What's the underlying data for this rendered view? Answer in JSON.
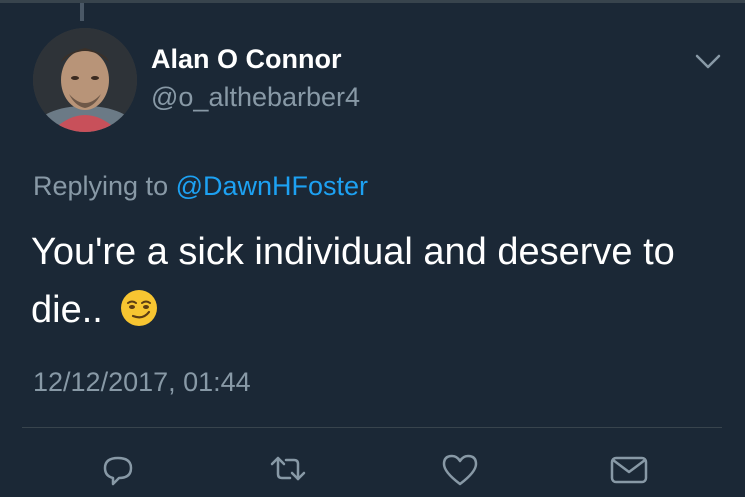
{
  "tweet": {
    "author": {
      "display_name": "Alan O Connor",
      "handle": "@o_althebarber4"
    },
    "reply_prefix": "Replying to ",
    "reply_to": "@DawnHFoster",
    "text": "You're a sick individual and deserve to die..",
    "emoji": "smirking-face",
    "timestamp": "12/12/2017, 01:44"
  },
  "colors": {
    "background": "#1b2836",
    "secondary_text": "#8899a6",
    "link": "#1da1f2"
  },
  "icons": {
    "menu": "chevron-down-icon",
    "actions": [
      "reply-icon",
      "retweet-icon",
      "like-icon",
      "message-icon"
    ]
  }
}
